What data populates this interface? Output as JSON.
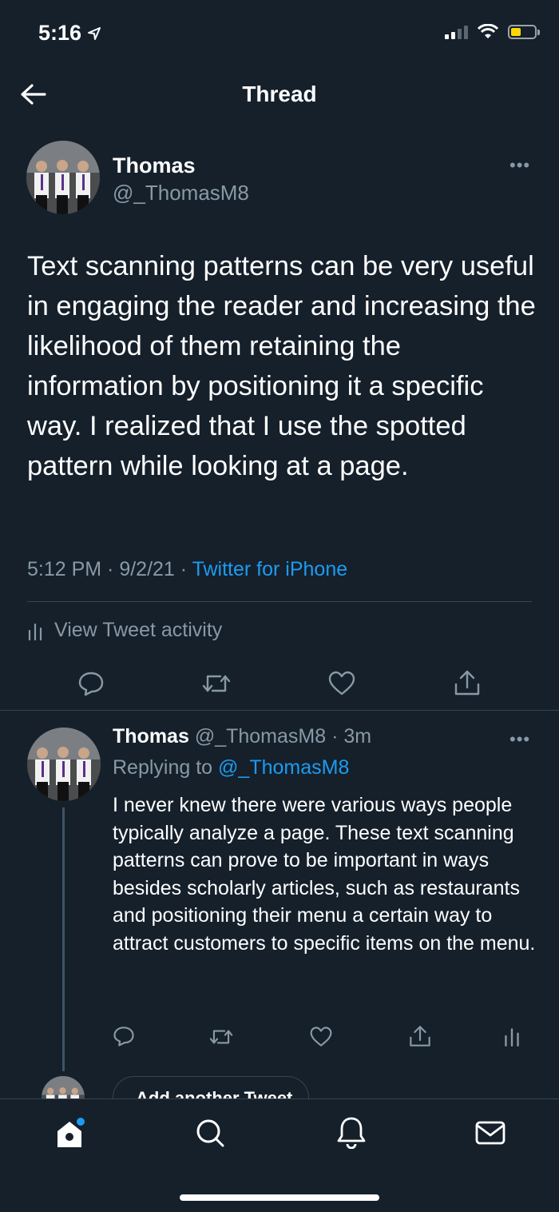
{
  "status_bar": {
    "time": "5:16"
  },
  "header": {
    "title": "Thread"
  },
  "main_tweet": {
    "display_name": "Thomas",
    "handle": "@_ThomasM8",
    "text": "Text scanning patterns can be very useful in engaging the reader and increasing the likelihood of them retaining the information by positioning it a specific way. I realized that I use the spotted pattern while looking at a page.",
    "time": "5:12 PM",
    "date": "9/2/21",
    "source": "Twitter for iPhone",
    "activity_label": "View Tweet activity"
  },
  "reply_tweet": {
    "display_name": "Thomas",
    "handle": "@_ThomasM8",
    "age": "3m",
    "replying_label": "Replying to",
    "replying_to": "@_ThomasM8",
    "text": "I never knew there were various ways people typically analyze a page. These text scanning patterns can prove to be important in ways besides scholarly articles, such as restaurants and positioning their menu a certain way to attract customers to specific items on the menu."
  },
  "compose": {
    "add_label": "Add another Tweet"
  },
  "colors": {
    "background": "#15202b",
    "accent": "#1d9bf0",
    "muted": "#8899a6",
    "divider": "#38444d"
  },
  "tabs": [
    {
      "icon": "home-icon",
      "has_dot": true
    },
    {
      "icon": "search-icon"
    },
    {
      "icon": "bell-icon"
    },
    {
      "icon": "mail-icon"
    }
  ]
}
